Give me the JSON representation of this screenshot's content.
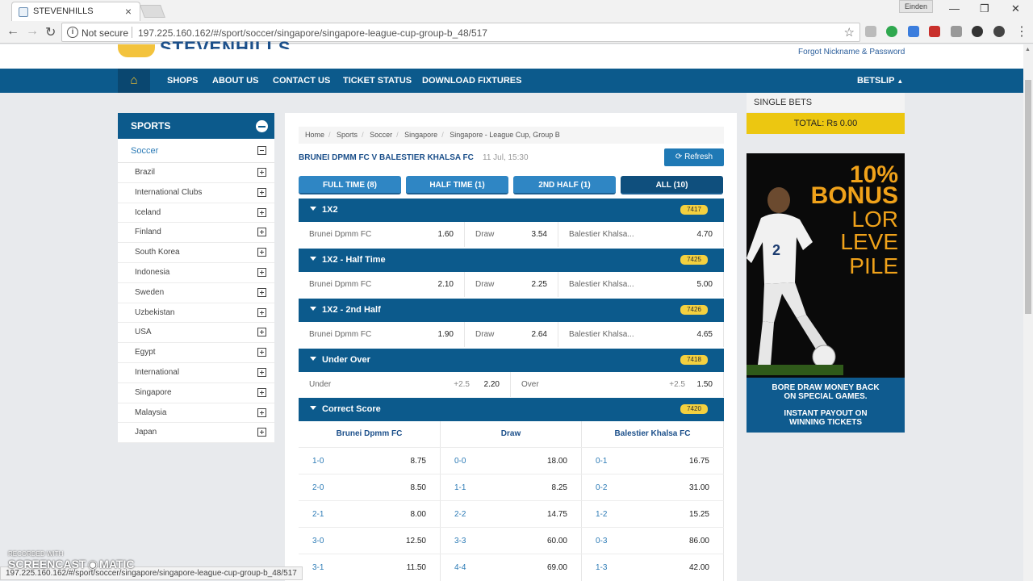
{
  "browser": {
    "tab_title": "STEVENHILLS",
    "profile": "Einden",
    "not_secure": "Not secure",
    "url": "197.225.160.162/#/sport/soccer/singapore/singapore-league-cup-group-b_48/517",
    "status_url": "197.225.160.162/#/sport/soccer/singapore/singapore-league-cup-group-b_48/517"
  },
  "site": {
    "logo_text": "STEVENHILLS",
    "forgot": "Forgot Nickname & Password",
    "nav": [
      "SHOPS",
      "ABOUT US",
      "CONTACT US",
      "TICKET STATUS",
      "DOWNLOAD FIXTURES"
    ],
    "betslip": "BETSLIP"
  },
  "sidebar": {
    "title": "SPORTS",
    "sport": "Soccer",
    "countries": [
      "Brazil",
      "International Clubs",
      "Iceland",
      "Finland",
      "South Korea",
      "Indonesia",
      "Sweden",
      "Uzbekistan",
      "USA",
      "Egypt",
      "International",
      "Singapore",
      "Malaysia",
      "Japan"
    ]
  },
  "main": {
    "breadcrumb": [
      "Home",
      "Sports",
      "Soccer",
      "Singapore",
      "Singapore - League Cup, Group B"
    ],
    "match": "BRUNEI DPMM FC V BALESTIER KHALSA FC",
    "time": "11 Jul, 15:30",
    "refresh": "Refresh",
    "tabs": [
      "FULL TIME (8)",
      "HALF TIME (1)",
      "2ND HALF (1)",
      "ALL (10)"
    ],
    "markets": [
      {
        "name": "1X2",
        "code": "7417",
        "home": "Brunei Dpmm FC",
        "home_odd": "1.60",
        "draw": "Draw",
        "draw_odd": "3.54",
        "away": "Balestier Khalsa...",
        "away_odd": "4.70"
      },
      {
        "name": "1X2 - Half Time",
        "code": "7425",
        "home": "Brunei Dpmm FC",
        "home_odd": "2.10",
        "draw": "Draw",
        "draw_odd": "2.25",
        "away": "Balestier Khalsa...",
        "away_odd": "5.00"
      },
      {
        "name": "1X2 - 2nd Half",
        "code": "7426",
        "home": "Brunei Dpmm FC",
        "home_odd": "1.90",
        "draw": "Draw",
        "draw_odd": "2.64",
        "away": "Balestier Khalsa...",
        "away_odd": "4.65"
      }
    ],
    "under_over": {
      "name": "Under Over",
      "code": "7418",
      "under": "Under",
      "under_hc": "+2.5",
      "under_odd": "2.20",
      "over": "Over",
      "over_hc": "+2.5",
      "over_odd": "1.50"
    },
    "correct_score": {
      "name": "Correct Score",
      "code": "7420",
      "cols": [
        "Brunei Dpmm FC",
        "Draw",
        "Balestier Khalsa FC"
      ],
      "rows": [
        [
          [
            "1-0",
            "8.75"
          ],
          [
            "0-0",
            "18.00"
          ],
          [
            "0-1",
            "16.75"
          ]
        ],
        [
          [
            "2-0",
            "8.50"
          ],
          [
            "1-1",
            "8.25"
          ],
          [
            "0-2",
            "31.00"
          ]
        ],
        [
          [
            "2-1",
            "8.00"
          ],
          [
            "2-2",
            "14.75"
          ],
          [
            "1-2",
            "15.25"
          ]
        ],
        [
          [
            "3-0",
            "12.50"
          ],
          [
            "3-3",
            "60.00"
          ],
          [
            "0-3",
            "86.00"
          ]
        ],
        [
          [
            "3-1",
            "11.50"
          ],
          [
            "4-4",
            "69.00"
          ],
          [
            "1-3",
            "42.00"
          ]
        ]
      ]
    }
  },
  "betslip_panel": {
    "single": "SINGLE BETS",
    "total": "TOTAL: Rs 0.00"
  },
  "ad": {
    "line1": "10%",
    "line2": "BONUS",
    "line3": "LOR",
    "line4": "LEVE",
    "line5": "PILE",
    "bottom1": "BORE DRAW MONEY BACK",
    "bottom2": "ON SPECIAL GAMES.",
    "bottom3": "INSTANT PAYOUT ON",
    "bottom4": "WINNING TICKETS"
  },
  "watermark": {
    "line1": "RECORDED WITH",
    "line2": "SCREENCAST",
    "line3": "MATIC"
  },
  "colors": {
    "brand_blue": "#0c5a8c",
    "accent_yellow": "#ecc711",
    "button_blue": "#2f86c4"
  }
}
